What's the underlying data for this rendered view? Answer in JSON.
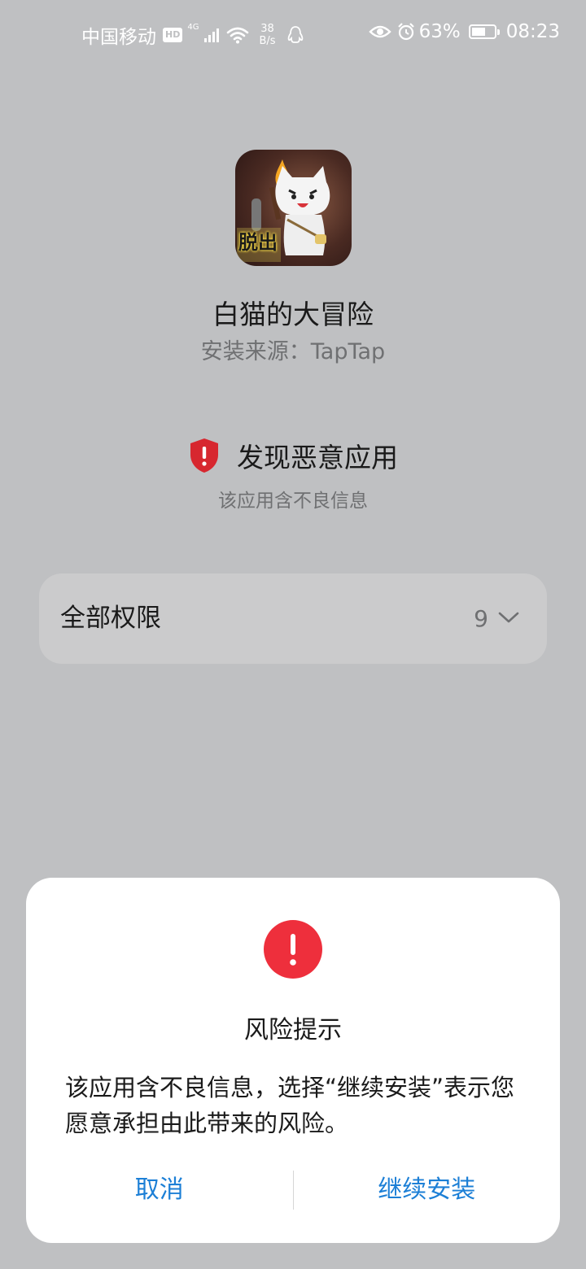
{
  "status_bar": {
    "carrier": "中国移动",
    "hd": "HD",
    "network": "4G",
    "speed_value": "38",
    "speed_unit": "B/s",
    "battery_percent": "63%",
    "battery_level": 0.63,
    "time": "08:23"
  },
  "app": {
    "name": "白猫的大冒险",
    "source": "安装来源：TapTap",
    "icon_label": "脱出"
  },
  "warning": {
    "title": "发现恶意应用",
    "subtitle": "该应用含不良信息"
  },
  "permissions": {
    "label": "全部权限",
    "count": "9"
  },
  "dialog": {
    "title": "风险提示",
    "message": "该应用含不良信息，选择“继续安装”表示您愿意承担由此带来的风险。",
    "cancel_label": "取消",
    "continue_label": "继续安装"
  },
  "colors": {
    "background": "#bfc0c2",
    "accent_blue": "#1c7fd6",
    "danger_red": "#ee2f3c",
    "shield_red": "#d7272f"
  },
  "icons": {
    "signal": "signal-bars-icon",
    "wifi": "wifi-icon",
    "qq": "qq-penguin-icon",
    "eye": "eye-icon",
    "alarm": "alarm-clock-icon",
    "battery": "battery-icon",
    "shield": "shield-alert-icon",
    "chevron": "chevron-down-icon",
    "alert": "alert-circle-icon"
  }
}
